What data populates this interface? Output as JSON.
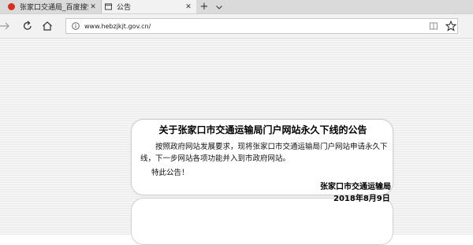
{
  "tabs": [
    {
      "label": "张家口交通局_百度搜索",
      "active": false,
      "close": "✕"
    },
    {
      "label": "公告",
      "active": true,
      "close": "✕"
    }
  ],
  "tabbar": {
    "new_tab": "+",
    "more": "⌄"
  },
  "address": {
    "url": "www.hebzjkjt.gov.cn/"
  },
  "colors": {
    "accent": "#d42f1f",
    "page_bg": "#f5f5f5"
  },
  "notice": {
    "title": "关于张家口市交通运输局门户网站永久下线的公告",
    "body": "按照政府网站发展要求，现将张家口市交通运输局门户网站申请永久下线，下一步网站各项功能并入到市政府网站。",
    "closing": "特此公告！",
    "signature": "张家口市交通运输局",
    "date": "2018年8月9日"
  },
  "icons": {
    "tab1": "baidu-icon",
    "tab2": "page-icon",
    "forward": "forward-arrow-icon",
    "refresh": "refresh-icon",
    "home": "home-icon",
    "info": "info-icon",
    "reading": "reading-view-icon",
    "favorite": "star-icon"
  }
}
